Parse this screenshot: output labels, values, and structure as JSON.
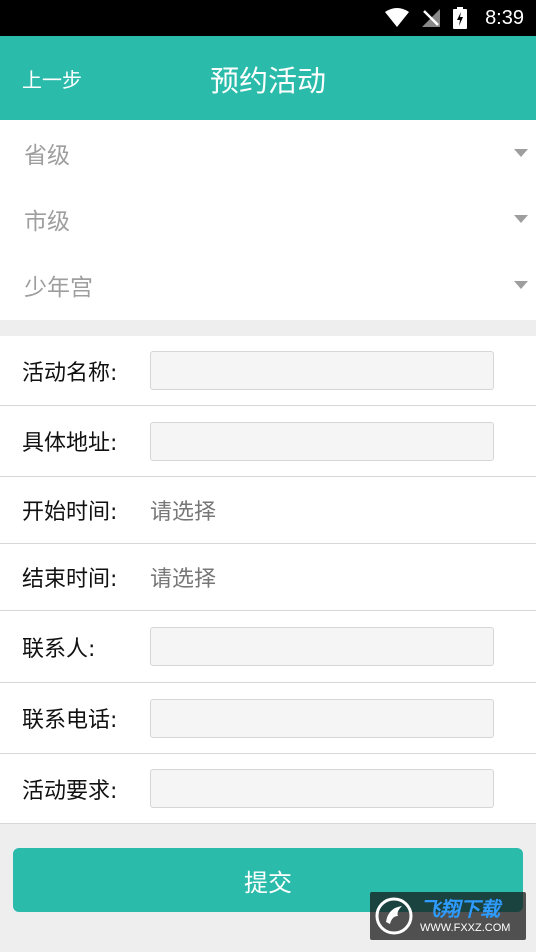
{
  "status_bar": {
    "time": "8:39"
  },
  "header": {
    "back_label": "上一步",
    "title": "预约活动"
  },
  "region_selectors": [
    {
      "label": "省级"
    },
    {
      "label": "市级"
    },
    {
      "label": "少年宫"
    }
  ],
  "form": {
    "activity_name_label": "活动名称:",
    "address_label": "具体地址:",
    "start_time_label": "开始时间:",
    "start_time_value": "请选择",
    "end_time_label": "结束时间:",
    "end_time_value": "请选择",
    "contact_label": "联系人:",
    "phone_label": "联系电话:",
    "requirements_label": "活动要求:"
  },
  "submit_label": "提交",
  "watermark": {
    "text": "飞翔下载",
    "url": "WWW.FXXZ.COM"
  },
  "colors": {
    "accent": "#2bbbab",
    "placeholder": "#9e9e9e"
  }
}
